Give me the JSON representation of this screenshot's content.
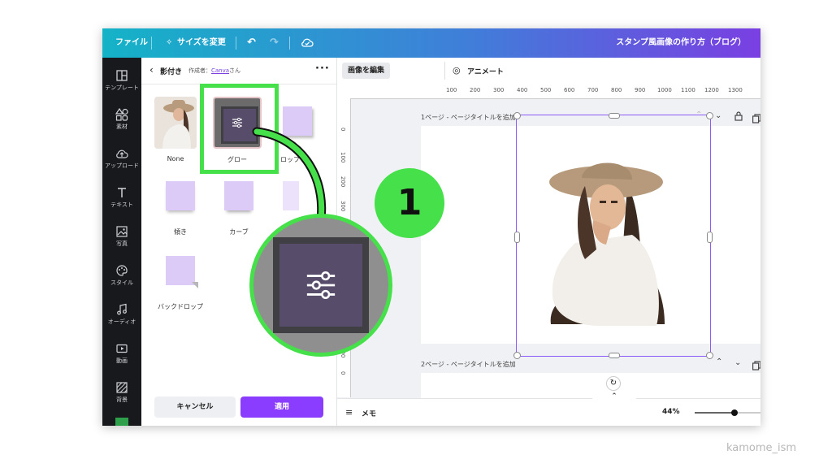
{
  "topbar": {
    "file": "ファイル",
    "resize": "サイズを変更",
    "doc_title": "スタンプ風画像の作り方（ブログ）"
  },
  "rail": [
    {
      "label": "テンプレート",
      "icon": "template-icon"
    },
    {
      "label": "素材",
      "icon": "elements-icon"
    },
    {
      "label": "アップロード",
      "icon": "upload-icon"
    },
    {
      "label": "テキスト",
      "icon": "text-icon"
    },
    {
      "label": "写真",
      "icon": "photo-icon"
    },
    {
      "label": "スタイル",
      "icon": "style-icon"
    },
    {
      "label": "オーディオ",
      "icon": "audio-icon"
    },
    {
      "label": "動画",
      "icon": "video-icon"
    },
    {
      "label": "背景",
      "icon": "background-icon"
    }
  ],
  "panel": {
    "title": "影付き",
    "author_prefix": "作成者：",
    "author_link": "Canva",
    "author_suffix": "さん",
    "tiles": {
      "none": "None",
      "glow": "グロー",
      "drop": "ロップ",
      "angle": "傾き",
      "curve": "カーブ",
      "backdrop": "バックドロップ"
    },
    "cancel": "キャンセル",
    "apply": "適用"
  },
  "editor": {
    "edit_image": "画像を編集",
    "animate": "アニメート",
    "ruler_h": [
      "100",
      "200",
      "300",
      "400",
      "500",
      "600",
      "700",
      "800",
      "900",
      "1000",
      "1100",
      "1200",
      "1300"
    ],
    "ruler_v": [
      "0",
      "100",
      "200",
      "300",
      "900",
      "0"
    ],
    "page1": "1ページ - ページタイトルを追加",
    "page2": "2ページ - ページタイトルを追加",
    "memo": "メモ",
    "zoom": "44%",
    "zoom_fraction": 0.6
  },
  "overlay": {
    "step_number": "1"
  },
  "watermark": "kamome_ism",
  "colors": {
    "highlight": "#45e04a",
    "accent": "#8b3dff",
    "selection": "#8b5cf6",
    "tile_purple": "#dccaf7"
  }
}
